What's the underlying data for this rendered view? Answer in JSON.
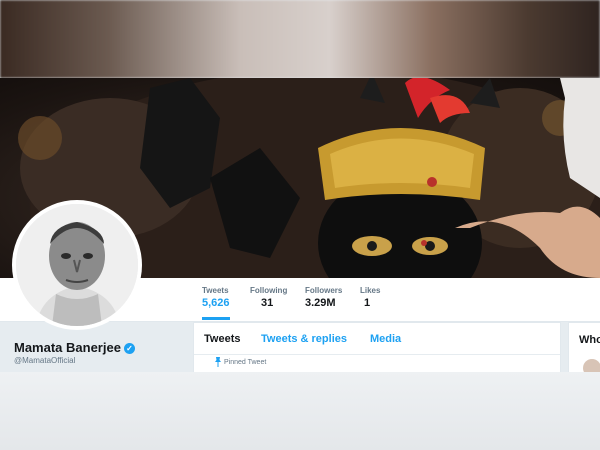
{
  "profile": {
    "name": "Mamata Banerjee",
    "handle": "@MamataOfficial",
    "verified_mark": "✓"
  },
  "stats": [
    {
      "label": "Tweets",
      "value": "5,626"
    },
    {
      "label": "Following",
      "value": "31"
    },
    {
      "label": "Followers",
      "value": "3.29M"
    },
    {
      "label": "Likes",
      "value": "1"
    }
  ],
  "tabs": [
    "Tweets",
    "Tweets & replies",
    "Media"
  ],
  "timeline": {
    "pinned_label": "Pinned Tweet"
  },
  "sidebar": {
    "who_title": "Who"
  },
  "colors": {
    "accent": "#1da1f2",
    "text": "#14171a",
    "muted": "#657786",
    "background": "#e6ecf0"
  },
  "icons": [
    "verified-badge-icon",
    "pin-icon"
  ]
}
